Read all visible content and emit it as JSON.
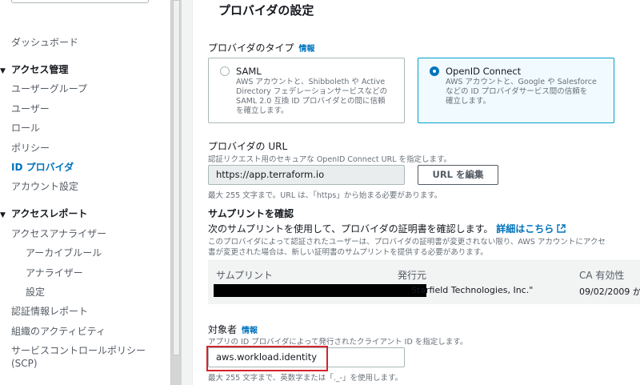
{
  "sidebar": {
    "dashboard": "ダッシュボード",
    "access_mgmt": {
      "label": "アクセス管理",
      "items": [
        "ユーザーグループ",
        "ユーザー",
        "ロール",
        "ポリシー",
        "ID プロバイダ",
        "アカウント設定"
      ],
      "active": "ID プロバイダ"
    },
    "access_reports": {
      "label": "アクセスレポート",
      "items": [
        "アクセスアナライザー"
      ],
      "sub_items": [
        "アーカイブルール",
        "アナライザー",
        "設定"
      ],
      "more": [
        "認証情報レポート",
        "組織のアクティビティ",
        "サービスコントロールポリシー",
        "(SCP)"
      ]
    }
  },
  "page": {
    "title": "プロバイダの設定",
    "provider_type": {
      "label": "プロバイダのタイプ",
      "info": "情報",
      "options": [
        {
          "title": "SAML",
          "desc": [
            "AWS アカウントと、Shibboleth や Active",
            "Directory フェデレーションサービスなどの",
            "SAML 2.0 互換 ID プロバイダとの間に信頼",
            "を確立します。"
          ],
          "selected": false
        },
        {
          "title": "OpenID Connect",
          "desc": [
            "AWS アカウントと、Google や Salesforce",
            "などの ID プロバイダサービス間の信頼を",
            "確立します。"
          ],
          "selected": true
        }
      ]
    },
    "provider_url": {
      "label": "プロバイダの URL",
      "desc": "認証リクエスト用のセキュアな OpenID Connect URL を指定します。",
      "value": "https://app.terraform.io",
      "edit_button": "URL を編集",
      "hint": "最大 255 文字まで。URL は、「https」から始まる必要があります。"
    },
    "thumbprint": {
      "title": "サムプリントを確認",
      "body": "次のサムプリントを使用して、プロバイダの証明書を確認します。",
      "link": "詳細はこちら",
      "desc1": "このプロバイダによって認証されたユーザーは、プロバイダの証明書が変更されない限り、AWS アカウントにアクセ",
      "desc2": "書が変更された場合は、新しい証明書のサムプリントを提供する必要があります。",
      "columns": [
        "サムプリント",
        "発行元",
        "CA 有効性"
      ],
      "row": {
        "issuer": "Starfield Technologies, Inc.\"",
        "validity": "09/02/2009 か"
      }
    },
    "audience": {
      "label": "対象者",
      "info": "情報",
      "desc": "アプリの ID プロバイダによって発行されたクライアント ID を指定します。",
      "value": "aws.workload.identity",
      "hint": "最大 255 文字まで、英数字または「._-」を使用します。"
    }
  },
  "colors": {
    "link": "#0073bb",
    "highlight": "#d5232c",
    "selected_border": "#00a1c9"
  }
}
